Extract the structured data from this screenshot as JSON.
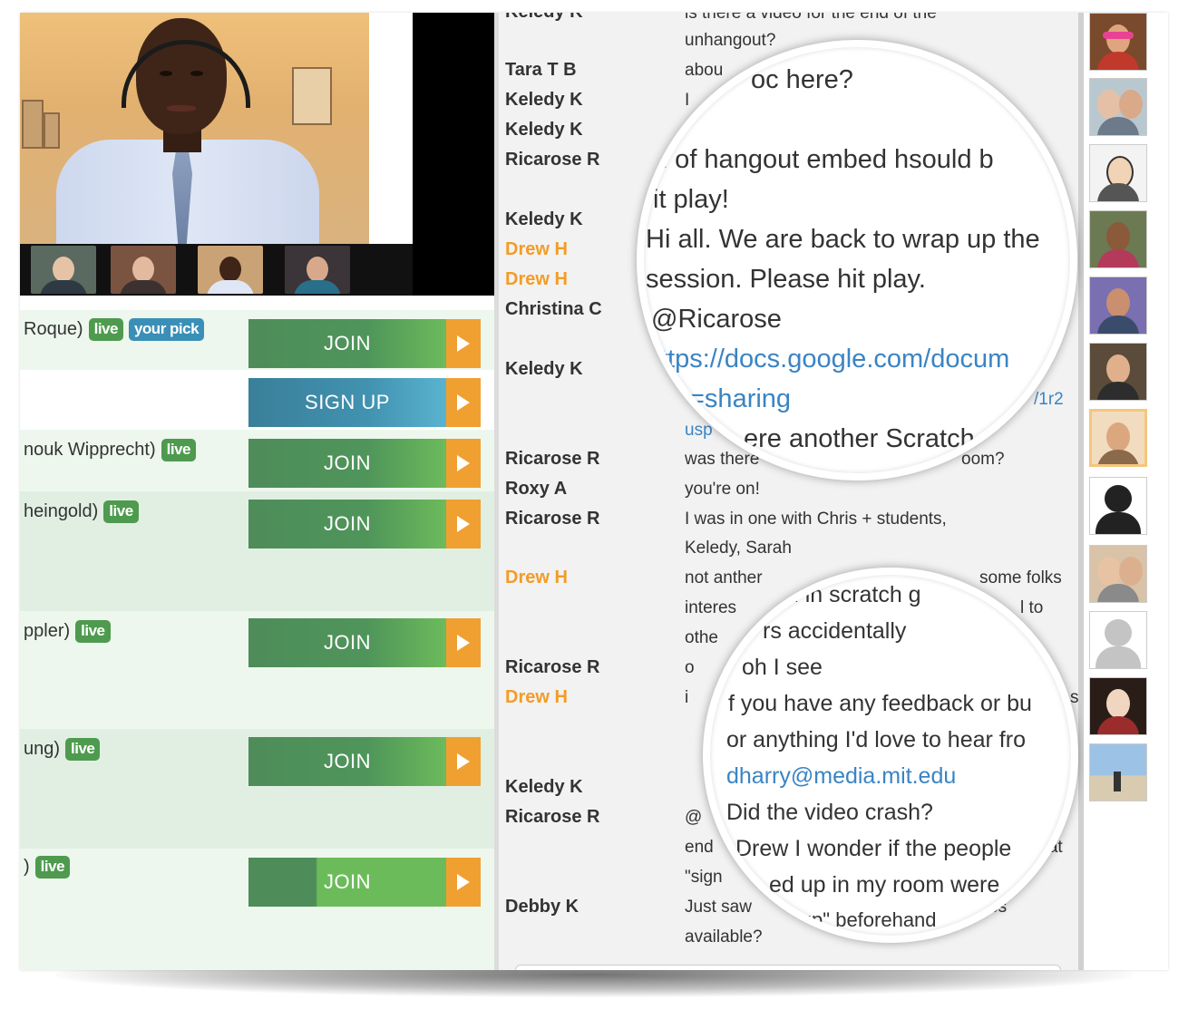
{
  "hangouts": [
    {
      "name": "Roque)",
      "badges": [
        "live",
        "your pick"
      ],
      "button": "JOIN"
    },
    {
      "name": "",
      "badges": [],
      "button": "SIGN UP"
    },
    {
      "name": "nouk Wipprecht)",
      "badges": [
        "live"
      ],
      "button": "JOIN"
    },
    {
      "name": "heingold)",
      "badges": [
        "live"
      ],
      "button": "JOIN"
    },
    {
      "name": "ppler)",
      "badges": [
        "live"
      ],
      "button": "JOIN"
    },
    {
      "name": "ung)",
      "badges": [
        "live"
      ],
      "button": "JOIN"
    },
    {
      "name": ")",
      "badges": [
        "live"
      ],
      "button": "JOIN"
    }
  ],
  "chat": {
    "messages": [
      {
        "name": "Keledy K",
        "lines": [
          "is there a video for the end of the",
          "unhangout?"
        ]
      },
      {
        "name": "Tara T B",
        "lines": [
          "abou"
        ]
      },
      {
        "name": "Keledy K",
        "lines": [
          "I"
        ]
      },
      {
        "name": "Keledy K",
        "lines": [
          ""
        ]
      },
      {
        "name": "Ricarose R",
        "lines": [
          ""
        ]
      },
      {
        "name": "Keledy K",
        "lines": [
          ""
        ]
      },
      {
        "name": "Drew H",
        "lines": [
          ""
        ],
        "highlight": true
      },
      {
        "name": "Drew H",
        "lines": [
          ""
        ],
        "highlight": true
      },
      {
        "name": "Christina C",
        "lines": [
          ""
        ]
      },
      {
        "name": "Keledy K",
        "lines": [
          "",
          "/1r2",
          "usp"
        ]
      },
      {
        "name": "Ricarose R",
        "lines": [
          "was there",
          "oom?"
        ]
      },
      {
        "name": "Roxy A",
        "lines": [
          "you're on!"
        ]
      },
      {
        "name": "Ricarose R",
        "lines": [
          "I was in one with Chris + students,",
          "Keledy, Sarah"
        ]
      },
      {
        "name": "Drew H",
        "lines": [
          "not anther",
          "some folks",
          "interes",
          "l to",
          "othe",
          "o"
        ],
        "highlight": true
      },
      {
        "name": "Ricarose R",
        "lines": [
          ""
        ]
      },
      {
        "name": "Drew H",
        "lines": [
          "i",
          "s"
        ],
        "highlight": true
      },
      {
        "name": "Keledy K",
        "lines": [
          ""
        ]
      },
      {
        "name": "Ricarose R",
        "lines": [
          "@",
          "end",
          "that",
          "\"sign"
        ]
      },
      {
        "name": "Debby K",
        "lines": [
          "Just saw",
          "rchives",
          "available?"
        ]
      }
    ],
    "magnifier_top": [
      "oc here?",
      "d of hangout embed hsould b",
      "it play!",
      "Hi all. We are back to wrap up the",
      "session. Please hit play.",
      "@Ricarose",
      "ttps://docs.google.com/docum",
      "=sharing",
      "ere another Scratch"
    ],
    "magnifier_bottom": [
      "ed in scratch g",
      "rs accidentally",
      "oh I see",
      "f you have any feedback or bu",
      "or anything I'd love to hear fro",
      "dharry@media.mit.edu",
      "Did the video crash?",
      "Drew I wonder if the people",
      "ed up in my room were",
      "\"up\" beforehand"
    ]
  },
  "colors": {
    "live_badge": "#4e9a4e",
    "pick_badge": "#3a8fb7",
    "join_button": "#4f955a",
    "signup_button": "#4192b0",
    "arrow": "#f0a030",
    "highlight_name": "#f39c28",
    "link": "#3a84c4"
  },
  "avatars": [
    "sunglasses-woman",
    "two-friends",
    "cartoon-man",
    "woman-smiling",
    "man-outdoors",
    "woman-glasses",
    "woman-portrait-selected",
    "default-avatar-dark",
    "two-women",
    "default-avatar-light",
    "woman-red-hair",
    "beach-scene"
  ]
}
